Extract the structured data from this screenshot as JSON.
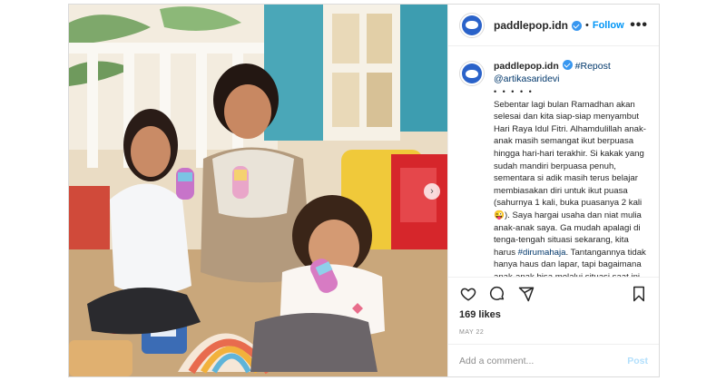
{
  "post": {
    "username": "paddlepop.idn",
    "follow_label": "Follow",
    "separator": "•",
    "more_label": "•••"
  },
  "caption": {
    "username": "paddlepop.idn",
    "repost": "#Repost",
    "mention": "@artikasaridevi",
    "dots": "• • • • •",
    "text_1": "Sebentar lagi bulan Ramadhan akan selesai dan kita siap-siap menyambut Hari Raya Idul Fitri. Alhamdulillah anak-anak masih semangat ikut berpuasa hingga hari-hari terakhir. Si kakak yang sudah mandiri berpuasa penuh, sementara si adik masih terus belajar membiasakan diri untuk ikut puasa (sahurnya 1 kali, buka puasanya 2 kali 😜). Saya hargai usaha dan niat mulia anak-anak saya. Ga mudah apalagi di tenga-tengah situasi sekarang, kita harus ",
    "hashtag": "#dirumahaja",
    "text_2": ". Tantangannya tidak hanya haus dan lapar, tapi bagaimana anak-anak bisa melalui situasi saat ini dengan penuh lapang dada."
  },
  "likes": "169 likes",
  "date": "MAY 22",
  "comment": {
    "placeholder": "Add a comment...",
    "post_label": "Post"
  },
  "icons": {
    "heart": "heart-icon",
    "comment": "comment-icon",
    "share": "share-icon",
    "bookmark": "bookmark-icon"
  },
  "colors": {
    "accent": "#0095f6",
    "verified": "#3897f0",
    "post_disabled": "#b2dffc"
  }
}
